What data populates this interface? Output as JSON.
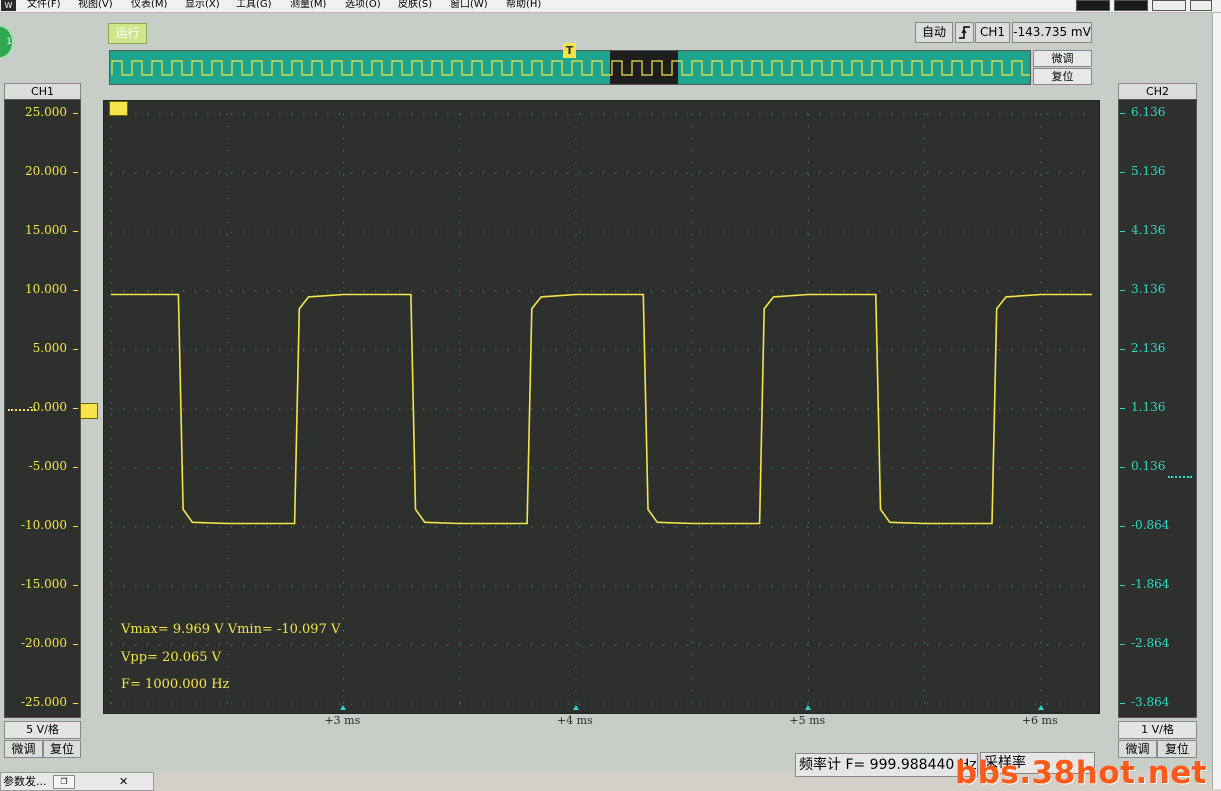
{
  "menu": {
    "app_icon": "W",
    "items": [
      "文件(F)",
      "视图(V)",
      "仪表(M)",
      "显示(X)",
      "工具(G)",
      "测量(M)",
      "选项(O)",
      "皮肤(S)",
      "窗口(W)",
      "帮助(H)"
    ]
  },
  "toolbar": {
    "run_label": "运行"
  },
  "trigger": {
    "mode": "自动",
    "edge_icon": "rising-edge-icon",
    "channel": "CH1",
    "level": "-143.735 mV",
    "fine_label": "微调",
    "reset_label": "复位",
    "marker": "T"
  },
  "ch1": {
    "title": "CH1",
    "ticks": [
      "25.000",
      "20.000",
      "15.000",
      "10.000",
      "5.000",
      "-0.000",
      "-5.000",
      "-10.000",
      "-15.000",
      "-20.000",
      "-25.000"
    ],
    "scale": "5 V/格",
    "fine_label": "微调",
    "reset_label": "复位",
    "color": "#f5e54a"
  },
  "ch2": {
    "title": "CH2",
    "ticks": [
      "6.136",
      "5.136",
      "4.136",
      "3.136",
      "2.136",
      "1.136",
      "0.136",
      "-0.864",
      "-1.864",
      "-2.864",
      "-3.864"
    ],
    "scale": "1 V/格",
    "fine_label": "微调",
    "reset_label": "复位",
    "color": "#2ed6c8"
  },
  "time_axis": {
    "labels": [
      "+3 ms",
      "+4 ms",
      "+5 ms",
      "+6 ms"
    ]
  },
  "measurements": {
    "vmax_vmin": "Vmax= 9.969 V  Vmin= -10.097 V",
    "vpp": "Vpp= 20.065 V",
    "freq": "F= 1000.000 Hz"
  },
  "status": {
    "freq_counter": "频率计  F= 999.988440 Hz",
    "sample_rate": "采样率 "
  },
  "taskbar": {
    "item_label": "参数发...",
    "restore_icon": "restore-icon",
    "close_label": "✕"
  },
  "watermark": "bbs.38hot.net",
  "chart_data": {
    "type": "line",
    "title": "",
    "xlabel": "",
    "ylabel": "",
    "x_unit": "ms",
    "ylim": [
      -25,
      25
    ],
    "x_ticks": [
      3,
      4,
      5,
      6
    ],
    "series": [
      {
        "x": [
          2.0,
          2.29,
          2.31,
          2.35,
          2.5,
          2.79,
          2.81,
          2.85,
          3.0,
          3.29,
          3.31,
          3.35,
          3.5,
          3.79,
          3.81,
          3.85,
          4.0,
          4.29,
          4.31,
          4.35,
          4.5,
          4.79,
          4.81,
          4.85,
          5.0,
          5.29,
          5.31,
          5.35,
          5.5,
          5.79,
          5.81,
          5.85,
          6.0,
          6.22
        ],
        "values": [
          9.7,
          9.7,
          -8.5,
          -9.6,
          -9.7,
          -9.7,
          8.5,
          9.5,
          9.7,
          9.7,
          -8.5,
          -9.6,
          -9.7,
          -9.7,
          8.5,
          9.5,
          9.7,
          9.7,
          -8.5,
          -9.6,
          -9.7,
          -9.7,
          8.5,
          9.5,
          9.7,
          9.7,
          -8.5,
          -9.6,
          -9.7,
          -9.7,
          8.5,
          9.5,
          9.7,
          9.7
        ]
      }
    ],
    "grid": true
  }
}
